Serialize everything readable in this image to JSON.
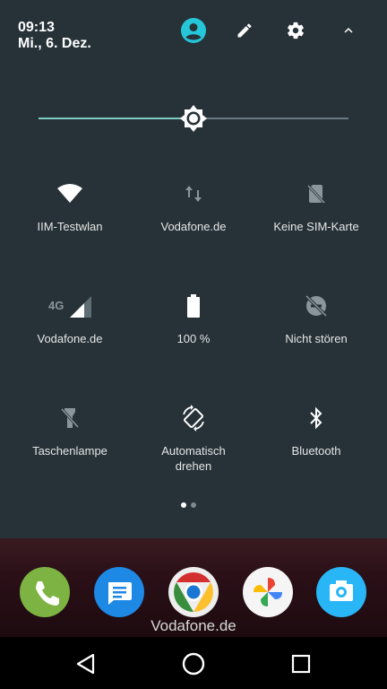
{
  "status": {
    "time": "09:13",
    "date": "Mi., 6. Dez."
  },
  "header_icons": [
    "user-account-icon",
    "edit-pencil-icon",
    "settings-gear-icon",
    "collapse-chevron-icon"
  ],
  "brightness": {
    "level": 0.5
  },
  "tiles": [
    {
      "label": "IIM-Testwlan",
      "icon": "wifi-icon",
      "active": true
    },
    {
      "label": "Vodafone.de",
      "icon": "mobile-data-icon",
      "active": false
    },
    {
      "label": "Keine SIM-Karte",
      "icon": "no-sim-icon",
      "active": false
    },
    {
      "label": "Vodafone.de",
      "icon": "cellular-signal-icon",
      "badge": "4G",
      "active": false
    },
    {
      "label": "100 %",
      "icon": "battery-icon",
      "active": true
    },
    {
      "label": "Nicht stören",
      "icon": "do-not-disturb-icon",
      "active": false
    },
    {
      "label": "Taschenlampe",
      "icon": "flashlight-icon",
      "active": false
    },
    {
      "label": "Automatisch\ndrehen",
      "icon": "auto-rotate-icon",
      "active": true
    },
    {
      "label": "Bluetooth",
      "icon": "bluetooth-icon",
      "active": true
    }
  ],
  "pager": {
    "pages": 2,
    "current": 1
  },
  "dock": {
    "apps": [
      "phone-app-icon",
      "messages-app-icon",
      "chrome-app-icon",
      "photos-app-icon",
      "camera-app-icon"
    ],
    "carrier_label": "Vodafone.de"
  },
  "nav": [
    "back-button",
    "home-button",
    "recents-button"
  ],
  "colors": {
    "panel": "#263238",
    "accent": "#80cbc4",
    "inactive": "#8a969c",
    "active": "#ffffff",
    "account": "#26c6da"
  }
}
